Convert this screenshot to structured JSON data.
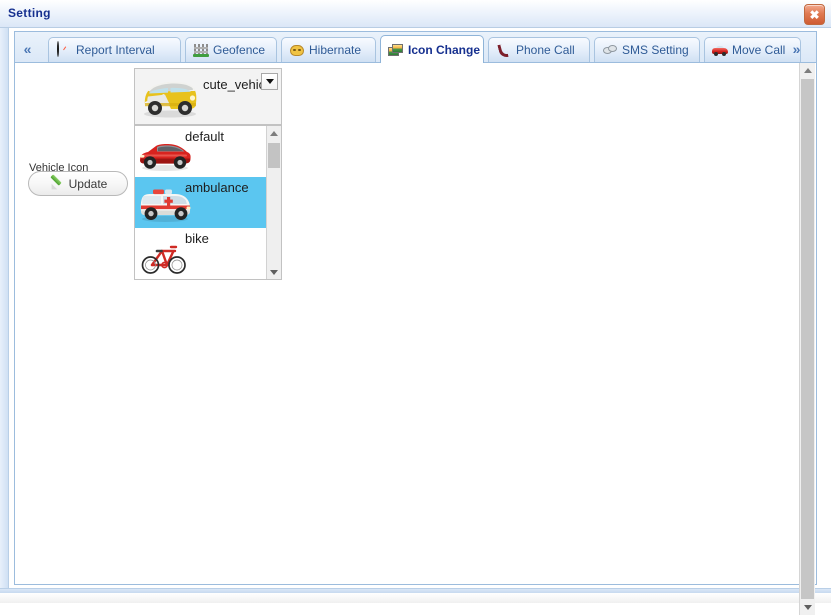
{
  "window": {
    "title": "Setting",
    "close_label": "✖"
  },
  "tabs": {
    "scroll_left": "«",
    "scroll_right": "»",
    "items": [
      {
        "label": "Report Interval",
        "icon": "clock-icon",
        "active": false
      },
      {
        "label": "Geofence",
        "icon": "fence-icon",
        "active": false
      },
      {
        "label": "Hibernate",
        "icon": "mask-icon",
        "active": false
      },
      {
        "label": "Icon Change",
        "icon": "image-swap-icon",
        "active": true
      },
      {
        "label": "Phone Call",
        "icon": "phone-icon",
        "active": false
      },
      {
        "label": "SMS Setting",
        "icon": "sms-icon",
        "active": false
      },
      {
        "label": "Move Call",
        "icon": "car-icon",
        "active": false
      }
    ]
  },
  "form": {
    "vehicle_icon_label": "Vehicle Icon",
    "update_label": "Update"
  },
  "combo": {
    "selected_value": "cute_vehicle",
    "selected_thumb": "yellow-van",
    "arrow_icon": "chevron-down-icon"
  },
  "dropdown": {
    "options": [
      {
        "label": "default",
        "thumb": "red-convertible",
        "selected": false
      },
      {
        "label": "ambulance",
        "thumb": "ambulance",
        "selected": true
      },
      {
        "label": "bike",
        "thumb": "bicycle",
        "selected": false
      }
    ],
    "scroll_up_icon": "triangle-up-icon",
    "scroll_down_icon": "triangle-down-icon"
  },
  "outer_scrollbar": {
    "up_icon": "triangle-up-icon",
    "down_icon": "triangle-down-icon"
  },
  "colors": {
    "selection_highlight": "#5bc6f0",
    "title_text": "#16308f",
    "tab_text": "#2f5b96",
    "panel_border": "#9cbcdd",
    "close_button": "#cf5c33"
  }
}
